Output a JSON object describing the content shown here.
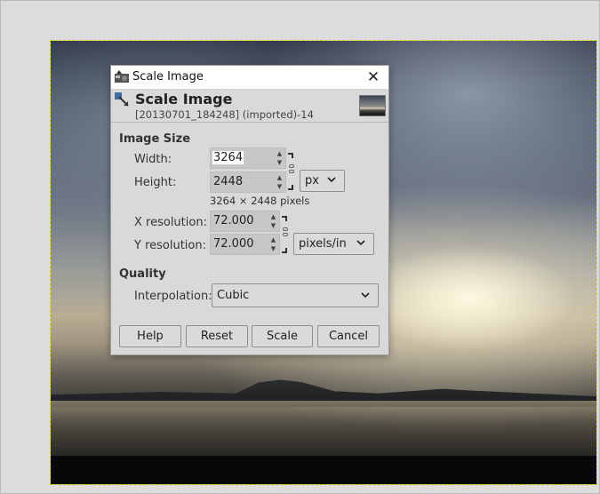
{
  "dialog": {
    "window_title": "Scale Image",
    "close_symbol": "✕",
    "header_title": "Scale Image",
    "header_subtitle": "[20130701_184248] (imported)-14",
    "icons": {
      "app": "gimp-app-icon",
      "scale": "scale-image-icon",
      "thumb": "image-thumbnail-icon"
    }
  },
  "image_size": {
    "section_label": "Image Size",
    "width_label": "Width:",
    "width_value": "3264",
    "height_label": "Height:",
    "height_value": "2448",
    "size_unit": "px",
    "pixels_note": "3264 × 2448 pixels",
    "x_res_label": "X resolution:",
    "x_res_value": "72.000",
    "y_res_label": "Y resolution:",
    "y_res_value": "72.000",
    "res_unit": "pixels/in"
  },
  "quality": {
    "section_label": "Quality",
    "interp_label": "Interpolation:",
    "interp_value": "Cubic"
  },
  "buttons": {
    "help": "Help",
    "reset": "Reset",
    "scale": "Scale",
    "cancel": "Cancel"
  },
  "colors": {
    "canvas_bg": "#dcdcdc",
    "dialog_bg": "#d9d9d9",
    "selection_border": "#d8d200"
  }
}
